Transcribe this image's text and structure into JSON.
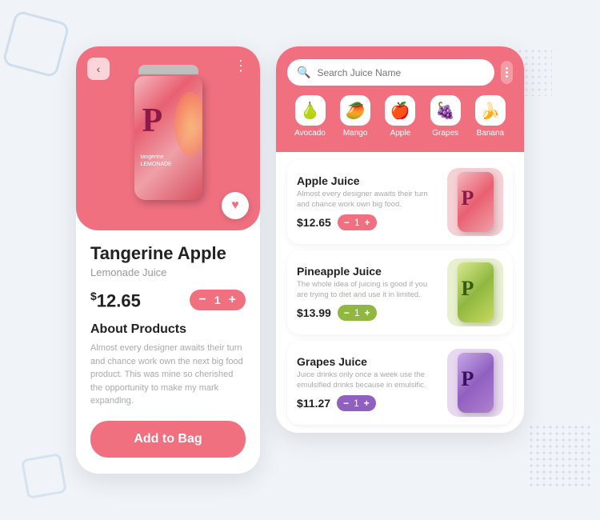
{
  "app": {
    "bg_color": "#f0f4f8"
  },
  "left_panel": {
    "back_icon": "‹",
    "more_icon": "⋮",
    "heart_icon": "♥",
    "product_name": "Tangerine Apple",
    "product_subtitle": "Lemonade Juice",
    "price_symbol": "$",
    "price": "12.65",
    "qty": "1",
    "about_title": "About Products",
    "about_text": "Almost every designer awaits their turn and chance work own the next big food product. This was mine so cherished the opportunity to make my mark expanding.",
    "add_btn_label": "Add to Bag"
  },
  "right_panel": {
    "search_placeholder": "Search Juice Name",
    "categories": [
      {
        "icon": "🍐",
        "label": "Avocado"
      },
      {
        "icon": "🥭",
        "label": "Mango"
      },
      {
        "icon": "🍎",
        "label": "Apple"
      },
      {
        "icon": "🍇",
        "label": "Grapes"
      },
      {
        "icon": "🍌",
        "label": "Banana"
      }
    ],
    "juices": [
      {
        "name": "Apple Juice",
        "desc": "Almost every designer awaits their turn and chance work own big food.",
        "price": "$12.65",
        "qty": "1",
        "can_bg": "#f5d0d5",
        "can_color": "#e86070",
        "qty_color": "#f07080"
      },
      {
        "name": "Pineapple Juice",
        "desc": "The whole idea of juicing is good if you are trying to diet and use it in limited.",
        "price": "$13.99",
        "qty": "1",
        "can_bg": "#e8f0d0",
        "can_color": "#90b840",
        "qty_color": "#90b840"
      },
      {
        "name": "Grapes Juice",
        "desc": "Juice drinks only once a week use the emulsified drinks because in emulsific.",
        "price": "$11.27",
        "qty": "1",
        "can_bg": "#e8d8f0",
        "can_color": "#9060c0",
        "qty_color": "#9060c0"
      }
    ]
  }
}
